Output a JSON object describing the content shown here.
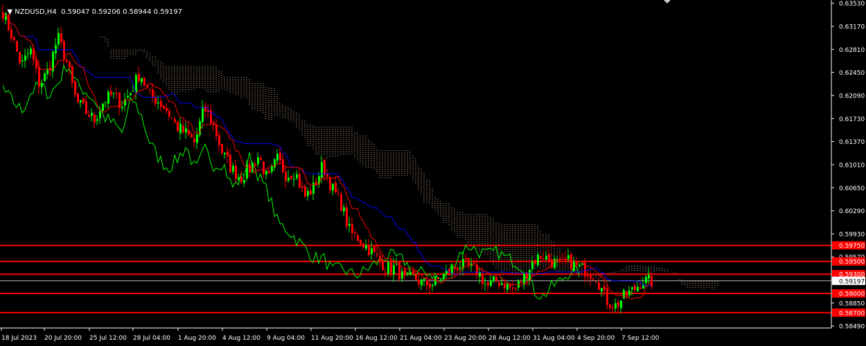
{
  "header": {
    "symbol_label": "NZDUSD,H4",
    "ohlc": "0.59047 0.59206 0.58944 0.59197"
  },
  "colors": {
    "background": "#000000",
    "bull": "#00ff00",
    "bear": "#ff0000",
    "kijun": "#0000ff",
    "tenkan": "#ff0000",
    "chikou": "#00ff00",
    "cloud_bear": "#ffdab9",
    "cloud_bull": "#ffffff",
    "level": "#ff0000",
    "current_price_bg": "#ffffff",
    "axis_text": "#ffffff"
  },
  "chart_data": {
    "type": "candlestick",
    "title": "NZDUSD,H4",
    "indicator": "Ichimoku Kinko Hyo",
    "ylim": [
      0.5846,
      0.6358
    ],
    "y_ticks": [
      "0.63530",
      "0.63170",
      "0.62810",
      "0.62450",
      "0.62090",
      "0.61730",
      "0.61370",
      "0.61010",
      "0.60650",
      "0.60290",
      "0.59930",
      "0.59570",
      "0.59210",
      "0.58850",
      "0.58490"
    ],
    "x_ticks": [
      "18 Jul 2023",
      "20 Jul 20:00",
      "25 Jul 12:00",
      "28 Jul 04:00",
      "1 Aug 20:00",
      "4 Aug 12:00",
      "9 Aug 04:00",
      "11 Aug 20:00",
      "16 Aug 12:00",
      "21 Aug 04:00",
      "23 Aug 20:00",
      "28 Aug 12:00",
      "31 Aug 04:00",
      "4 Sep 20:00",
      "7 Sep 12:00"
    ],
    "close_path": [
      0.634,
      0.63,
      0.6255,
      0.628,
      0.6225,
      0.625,
      0.63,
      0.626,
      0.62,
      0.6185,
      0.617,
      0.62,
      0.621,
      0.6195,
      0.6215,
      0.6245,
      0.621,
      0.62,
      0.6185,
      0.616,
      0.615,
      0.6135,
      0.619,
      0.6165,
      0.612,
      0.6095,
      0.608,
      0.6095,
      0.6115,
      0.6075,
      0.611,
      0.6085,
      0.609,
      0.605,
      0.6065,
      0.61,
      0.6065,
      0.604,
      0.5995,
      0.5985,
      0.597,
      0.5955,
      0.594,
      0.594,
      0.592,
      0.5925,
      0.5915,
      0.5915,
      0.5925,
      0.5935,
      0.5945,
      0.594,
      0.5935,
      0.591,
      0.592,
      0.5915,
      0.5905,
      0.5925,
      0.595,
      0.596,
      0.595,
      0.5945,
      0.595,
      0.594,
      0.5935,
      0.5925,
      0.589,
      0.588,
      0.5895,
      0.5905,
      0.592,
      0.5918
    ],
    "current_price": "0.59197",
    "levels": [
      {
        "value": 0.5975,
        "label": "0.59750"
      },
      {
        "value": 0.595,
        "label": "0.59500"
      },
      {
        "value": 0.593,
        "label": "0.59300"
      },
      {
        "value": 0.59,
        "label": "0.59000"
      },
      {
        "value": 0.587,
        "label": "0.58700"
      }
    ]
  }
}
